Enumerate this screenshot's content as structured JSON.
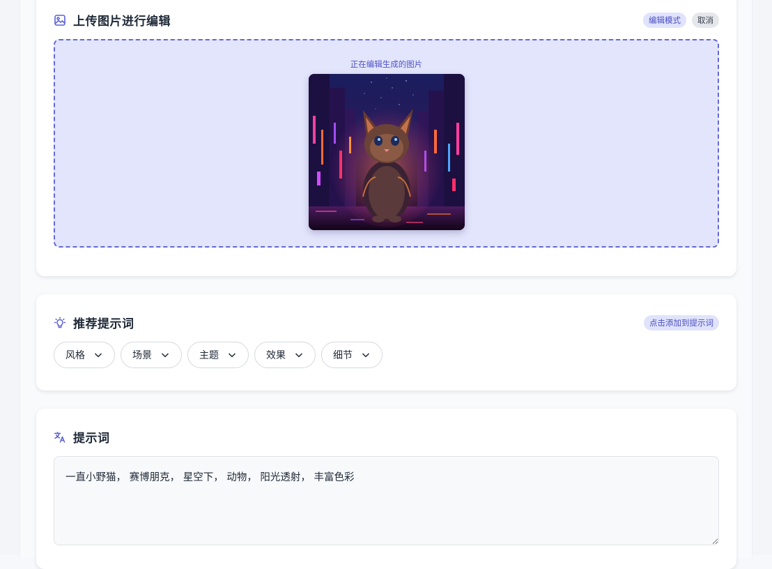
{
  "colors": {
    "accent": "#5a5fd6",
    "dropzone_bg": "#e3e5fc",
    "dropzone_border": "#6268d6"
  },
  "upload": {
    "title": "上传图片进行编辑",
    "icon": "image-icon",
    "mode_badge": "编辑模式",
    "cancel_label": "取消",
    "caption": "正在编辑生成的图片",
    "preview_image": "cyberpunk-kitten-image"
  },
  "suggest": {
    "title": "推荐提示词",
    "icon": "lightbulb-icon",
    "hint_badge": "点击添加到提示词",
    "chips": [
      {
        "label": "风格"
      },
      {
        "label": "场景"
      },
      {
        "label": "主题"
      },
      {
        "label": "效果"
      },
      {
        "label": "细节"
      }
    ]
  },
  "prompt": {
    "title": "提示词",
    "icon": "translate-icon",
    "value": "一直小野猫， 赛博朋克， 星空下， 动物， 阳光透射， 丰富色彩"
  }
}
